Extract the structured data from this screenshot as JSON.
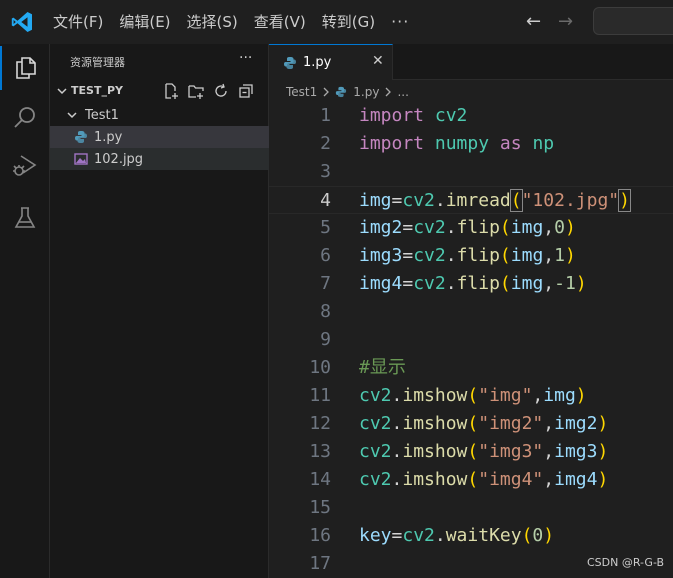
{
  "menu": [
    "文件(F)",
    "编辑(E)",
    "选择(S)",
    "查看(V)",
    "转到(G)",
    "···"
  ],
  "icons": {
    "back": "←",
    "forward": "→"
  },
  "explorer": {
    "title": "资源管理器",
    "more": "···",
    "folder": "TEST_PY",
    "subfolder": "Test1",
    "files": [
      "1.py",
      "102.jpg"
    ]
  },
  "tab": {
    "label": "1.py",
    "close": "✕"
  },
  "breadcrumb": {
    "folder": "Test1",
    "file": "1.py",
    "symbol": "..."
  },
  "code": {
    "line_numbers": [
      "1",
      "2",
      "3",
      "4",
      "5",
      "6",
      "7",
      "8",
      "9",
      "10",
      "11",
      "12",
      "13",
      "14",
      "15",
      "16",
      "17"
    ],
    "current_line": 4,
    "lines": [
      "import cv2",
      "import numpy as np",
      "",
      "img=cv2.imread(\"102.jpg\")",
      "img2=cv2.flip(img,0)",
      "img3=cv2.flip(img,1)",
      "img4=cv2.flip(img,-1)",
      "",
      "",
      "#显示",
      "cv2.imshow(\"img\",img)",
      "cv2.imshow(\"img2\",img2)",
      "cv2.imshow(\"img3\",img3)",
      "cv2.imshow(\"img4\",img4)",
      "",
      "key=cv2.waitKey(0)",
      ""
    ]
  },
  "watermark": "CSDN @R-G-B",
  "colors": {
    "accent": "#0078d4",
    "keyword": "#c586c0",
    "module": "#4ec9b0",
    "variable": "#9cdcfe",
    "function": "#dcdcaa",
    "string": "#ce9178",
    "number": "#b5cea8",
    "comment": "#6a9955"
  }
}
